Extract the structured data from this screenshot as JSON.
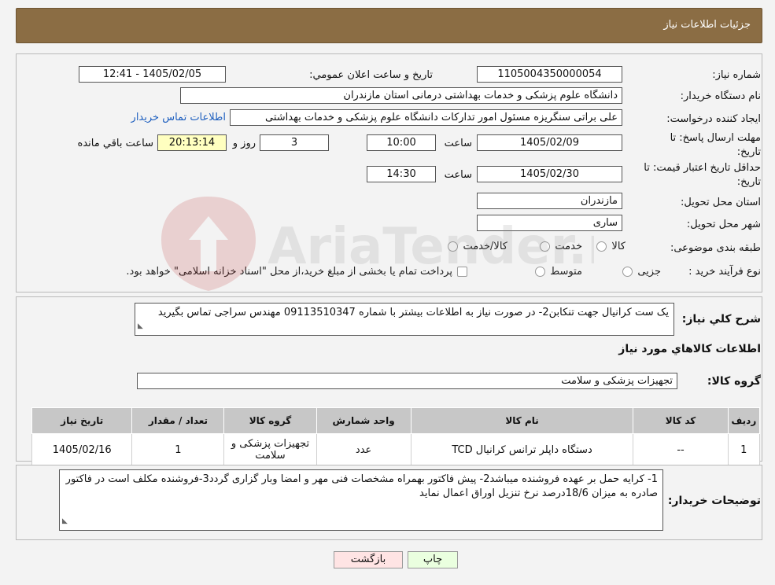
{
  "header": {
    "title": "جزئیات اطلاعات نیاز"
  },
  "form": {
    "need_number_label": "شماره نیاز:",
    "need_number": "1105004350000054",
    "announce_label": "تاريخ و ساعت اعلان عمومي:",
    "announce_value": "1405/02/05 - 12:41",
    "buyer_org_label": "نام دستگاه خریدار:",
    "buyer_org": "دانشگاه علوم پزشکی و خدمات بهداشتی  درمانی استان مازندران",
    "requester_label": "ایجاد کننده درخواست:",
    "requester": "علی براتی سنگریزه مسئول امور تدارکات دانشگاه علوم پزشکی و خدمات بهداشتی",
    "contact_link": "اطلاعات تماس خریدار",
    "deadline_label": "مهلت ارسال پاسخ: تا تاریخ:",
    "deadline_date": "1405/02/09",
    "time_label": "ساعت",
    "deadline_time": "10:00",
    "days_value": "3",
    "days_label": "روز و",
    "remaining_value": "20:13:14",
    "remaining_label": "ساعت باقي مانده",
    "price_validity_label": "حداقل تاریخ اعتبار قیمت: تا تاریخ:",
    "price_validity_date": "1405/02/30",
    "price_validity_time": "14:30",
    "province_label": "استان محل تحویل:",
    "province": "مازندران",
    "city_label": "شهر محل تحویل:",
    "city": "ساری",
    "category_label": "طبقه بندی موضوعی:",
    "category_options": [
      "کالا",
      "خدمت",
      "کالا/خدمت"
    ],
    "process_label": "نوع فرآیند خرید :",
    "process_options": [
      "جزیی",
      "متوسط"
    ],
    "process_note": "پرداخت تمام یا بخشی از مبلغ خرید،از محل \"اسناد خزانه اسلامی\" خواهد بود."
  },
  "summary": {
    "label": "شرح کلي نياز:",
    "text": "یک ست کرانیال جهت تنکابن2- در صورت نیاز به اطلاعات بیشتر با شماره 09113510347 مهندس سراجی تماس بگیرید"
  },
  "goods": {
    "section_title": "اطلاعات کالاهاي مورد نياز",
    "group_label": "گروه کالا:",
    "group_value": "تجهیزات پزشکی و سلامت",
    "columns": [
      "رديف",
      "کد کالا",
      "نام کالا",
      "واحد شمارش",
      "گروه کالا",
      "تعداد / مقدار",
      "تاریخ نیاز"
    ],
    "rows": [
      [
        "1",
        "--",
        "دستگاه داپلر ترانس کرانیال TCD",
        "عدد",
        "تجهیزات پزشکی و سلامت",
        "1",
        "1405/02/16"
      ]
    ]
  },
  "buyer_notes": {
    "label": "توضیحات خریدار:",
    "text": "1- کرایه حمل بر عهده فروشنده میباشد2- پیش فاکتور بهمراه مشخصات فنی مهر و امضا وبار گزاری گردد3-فروشنده مکلف است در فاکتور صادره به میزان 18/6درصد نرخ تنزیل اوراق اعمال نماید"
  },
  "buttons": {
    "print": "چاپ",
    "back": "بازگشت"
  },
  "watermark": {
    "text": "AriaTender.neT"
  },
  "colors": {
    "header_bg": "#8b6d44",
    "remaining_bg": "#ffffc0",
    "print_bg": "#eaffdf",
    "back_bg": "#ffe4e4",
    "link": "#1e5fbf"
  }
}
